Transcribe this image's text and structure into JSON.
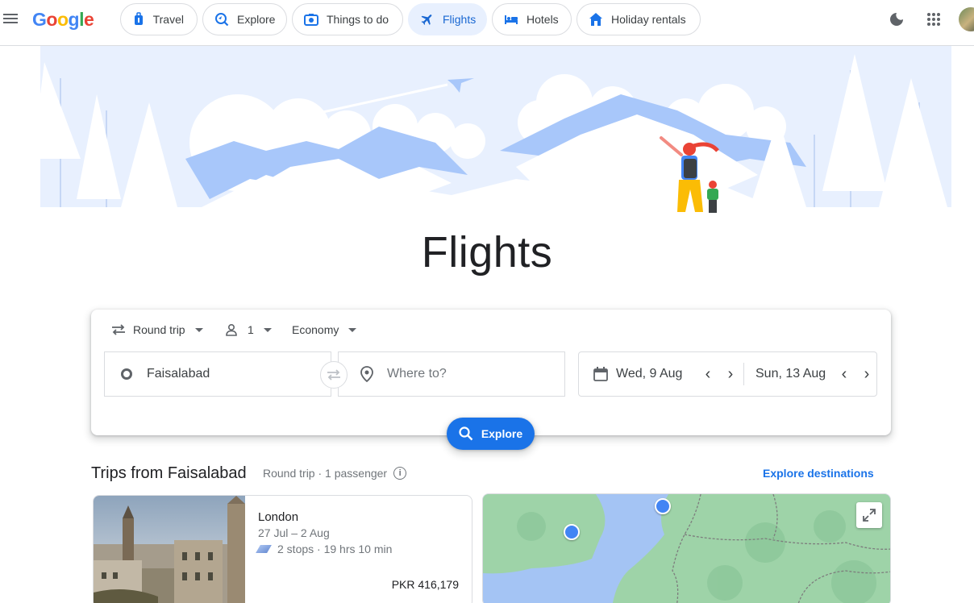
{
  "header": {
    "logo": [
      "G",
      "o",
      "o",
      "g",
      "l",
      "e"
    ],
    "nav": [
      {
        "label": "Travel",
        "icon": "luggage-icon"
      },
      {
        "label": "Explore",
        "icon": "explore-icon"
      },
      {
        "label": "Things to do",
        "icon": "camera-icon"
      },
      {
        "label": "Flights",
        "icon": "plane-icon",
        "active": true
      },
      {
        "label": "Hotels",
        "icon": "bed-icon"
      },
      {
        "label": "Holiday rentals",
        "icon": "house-icon"
      }
    ],
    "right_icons": [
      "dark-mode-icon",
      "apps-grid-icon",
      "avatar"
    ]
  },
  "hero": {
    "title": "Flights"
  },
  "search": {
    "trip_type": "Round trip",
    "passengers": "1",
    "cabin": "Economy",
    "origin": "Faisalabad",
    "destination_placeholder": "Where to?",
    "depart_date": "Wed, 9 Aug",
    "return_date": "Sun, 13 Aug",
    "explore_button": "Explore"
  },
  "trips": {
    "title": "Trips from Faisalabad",
    "subtitle": "Round trip · 1 passenger",
    "explore_link": "Explore destinations",
    "items": [
      {
        "city": "London",
        "dates": "27 Jul – 2 Aug",
        "stops": "2 stops · 19 hrs 10 min",
        "price": "PKR 416,179"
      }
    ]
  },
  "colors": {
    "accent": "#1a73e8",
    "active_chip_bg": "#e8f0fe",
    "hero_light": "#e8f0fe",
    "hero_mid": "#a8c7fa",
    "map_land": "#9ed3a8",
    "map_water": "#a4c4f4"
  }
}
